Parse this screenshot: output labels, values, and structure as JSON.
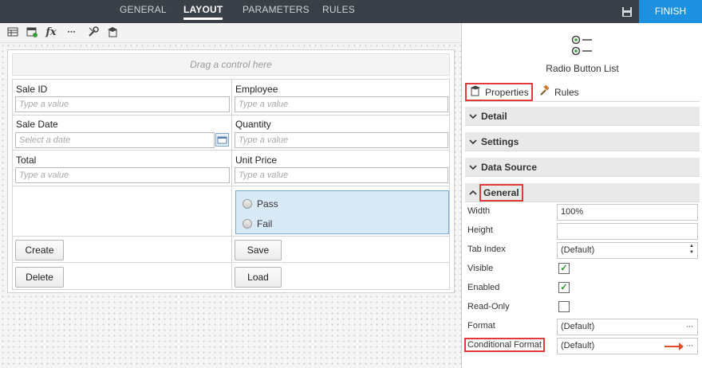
{
  "topbar": {
    "tabs": [
      {
        "label": "GENERAL"
      },
      {
        "label": "LAYOUT"
      },
      {
        "label": "PARAMETERS"
      },
      {
        "label": "RULES"
      }
    ],
    "active_tab": "LAYOUT",
    "finish_label": "FINISH"
  },
  "toolbar": {
    "icons": [
      "table-icon",
      "add-view-icon",
      "expression-icon",
      "more-icon",
      "tools-icon",
      "class-icon"
    ],
    "fx_glyph": "fx",
    "more_glyph": "▪▪▪"
  },
  "form": {
    "drag_placeholder": "Drag a control here",
    "fields": {
      "sale_id": {
        "label": "Sale ID",
        "placeholder": "Type a value"
      },
      "employee": {
        "label": "Employee",
        "placeholder": "Type a value"
      },
      "sale_date": {
        "label": "Sale Date",
        "placeholder": "Select a date"
      },
      "quantity": {
        "label": "Quantity",
        "placeholder": "Type a value"
      },
      "total": {
        "label": "Total",
        "placeholder": "Type a value"
      },
      "unit_price": {
        "label": "Unit Price",
        "placeholder": "Type a value"
      }
    },
    "radio_options": [
      "Pass",
      "Fail"
    ],
    "buttons": {
      "create": "Create",
      "save": "Save",
      "delete": "Delete",
      "load": "Load"
    }
  },
  "panel": {
    "control_name": "Radio Button List",
    "tabs": {
      "properties": "Properties",
      "rules": "Rules"
    },
    "sections": {
      "detail": "Detail",
      "settings": "Settings",
      "data_source": "Data Source",
      "general": "General"
    },
    "properties": {
      "width": {
        "label": "Width",
        "value": "100%"
      },
      "height": {
        "label": "Height",
        "value": ""
      },
      "tab_index": {
        "label": "Tab Index",
        "value": "(Default)"
      },
      "visible": {
        "label": "Visible",
        "checked": true
      },
      "enabled": {
        "label": "Enabled",
        "checked": true
      },
      "read_only": {
        "label": "Read-Only",
        "checked": false
      },
      "format": {
        "label": "Format",
        "value": "(Default)"
      },
      "conditional_format": {
        "label": "Conditional Format",
        "value": "(Default)"
      }
    },
    "check_glyph": "✓",
    "ellipsis": "···",
    "spin_up": "▲",
    "spin_down": "▼"
  },
  "colors": {
    "topbar": "#3a4048",
    "finish": "#1e90e0",
    "highlight": "#e03a3a",
    "radio_selection": "#d9eaf7"
  }
}
